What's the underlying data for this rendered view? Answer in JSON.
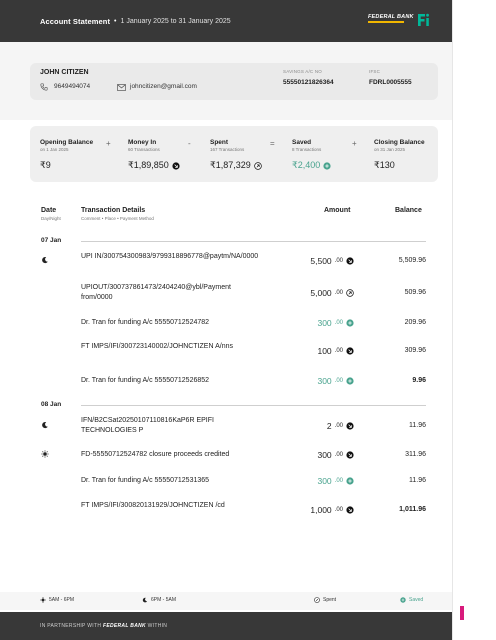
{
  "header": {
    "title": "Account Statement",
    "separator": "•",
    "period": "1 January 2025  to  31 January 2025",
    "bank_logo_text": "FEDERAL BANK"
  },
  "account": {
    "holder_name": "JOHN CITIZEN",
    "phone": "9649494074",
    "email": "johncitizen@gmail.com",
    "account_label": "SAVINGS A/C NO",
    "account_number": "55550121826364",
    "ifsc_label": "IFSC",
    "ifsc_code": "FDRL0005555"
  },
  "summary": {
    "opening": {
      "title": "Opening Balance",
      "sub": "on 1 Jan 2025",
      "value": "₹9"
    },
    "money_in": {
      "title": "Money In",
      "sub": "60 Transactions",
      "value": "₹1,89,850"
    },
    "spent": {
      "title": "Spent",
      "sub": "167 Transactions",
      "value": "₹1,87,329"
    },
    "saved": {
      "title": "Saved",
      "sub": "8 Transactions",
      "value": "₹2,400"
    },
    "closing": {
      "title": "Closing Balance",
      "sub": "on 31 Jan 2025",
      "value": "₹130"
    },
    "ops": [
      "+",
      "-",
      "=",
      "+"
    ]
  },
  "table": {
    "col_date": "Date",
    "col_date_sub": "Day/Night",
    "col_details": "Transaction Details",
    "col_details_sub": "Comment • Place • Payment Method",
    "col_amount": "Amount",
    "col_balance": "Balance"
  },
  "groups": [
    {
      "date": "07 Jan"
    },
    {
      "date": "08 Jan"
    }
  ],
  "transactions": [
    {
      "details": "UPI IN/300754300983/9799318896778@paytm/NA/0000",
      "amount": "5,500",
      "suffix": ".00",
      "balance": "5,509.96",
      "time_icon": "moon-icon"
    },
    {
      "details": "UPIOUT/300737861473/2404240@ybl/Payment from/0000",
      "amount": "5,000",
      "suffix": ".00",
      "balance": "509.96"
    },
    {
      "details": "Dr. Tran for funding A/c 55550712524782",
      "amount": "300",
      "suffix": ".00",
      "balance": "209.96"
    },
    {
      "details": "FT IMPS/IFI/300723140002/JOHNCTIZEN A/nns",
      "amount": "100",
      "suffix": ".00",
      "balance": "309.96"
    },
    {
      "details": "Dr. Tran for funding A/c 55550712526852",
      "amount": "300",
      "suffix": ".00",
      "balance": "9.96"
    },
    {
      "details": "IFN/B2CSat20250107110816KaP6R EPIFI TECHNOLOGIES P",
      "amount": "2",
      "suffix": ".00",
      "balance": "11.96",
      "time_icon": "moon-icon"
    },
    {
      "details": "FD-55550712524782 closure proceeds credited",
      "amount": "300",
      "suffix": ".00",
      "balance": "311.96",
      "time_icon": "sun-icon"
    },
    {
      "details": "Dr. Tran for funding A/c 55550712531365",
      "amount": "300",
      "suffix": ".00",
      "balance": "11.96"
    },
    {
      "details": "FT IMPS/IFI/300820131929/JOHNCTIZEN /cd",
      "amount": "1,000",
      "suffix": ".00",
      "balance": "1,011.96"
    }
  ],
  "legend": {
    "day": "5AM - 6PM",
    "night": "6PM - 5AM",
    "spent": "Spent",
    "saved": "Saved"
  },
  "footer": {
    "partnership": "IN PARTNERSHIP WITH",
    "bank": "FEDERAL BANK",
    "within": "WITHIN"
  },
  "colors": {
    "header_bg": "#383838",
    "saved_green": "#49a38e",
    "logo_gold": "#f1b600",
    "fi_green": "#00b899"
  }
}
